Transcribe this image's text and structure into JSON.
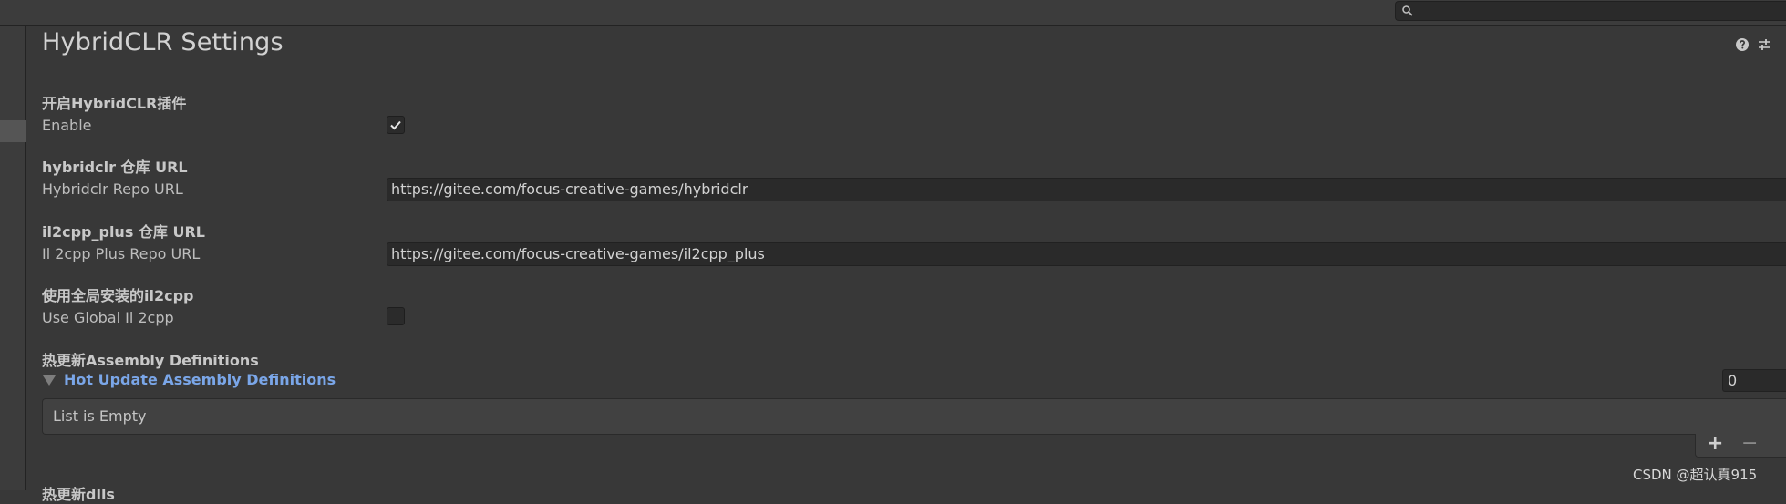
{
  "title": "HybridCLR Settings",
  "settings": {
    "enable": {
      "header": "开启HybridCLR插件",
      "label": "Enable",
      "checked": true
    },
    "hybridclr_repo": {
      "header": "hybridclr 仓库 URL",
      "label": "Hybridclr Repo URL",
      "value": "https://gitee.com/focus-creative-games/hybridclr"
    },
    "il2cpp_plus_repo": {
      "header": "il2cpp_plus 仓库 URL",
      "label": "Il 2cpp Plus Repo URL",
      "value": "https://gitee.com/focus-creative-games/il2cpp_plus"
    },
    "use_global_il2cpp": {
      "header": "使用全局安装的il2cpp",
      "label": "Use Global Il 2cpp",
      "checked": false
    },
    "hot_update_assembly_definitions": {
      "header": "热更新Assembly Definitions",
      "foldout_label": "Hot Update Assembly Definitions",
      "count": "0",
      "empty_text": "List is Empty",
      "add_label": "+",
      "remove_label": "−"
    },
    "next_header": "热更新dlls"
  },
  "watermark": "CSDN @超认真915",
  "icons": {
    "search": "search-icon",
    "help": "help-icon",
    "preset": "preset-icon",
    "checkmark": "checkmark-icon",
    "foldout": "triangle-down-icon"
  },
  "colors": {
    "background": "#383838",
    "field": "#2a2a2a",
    "accent_link": "#7aa6e8"
  }
}
